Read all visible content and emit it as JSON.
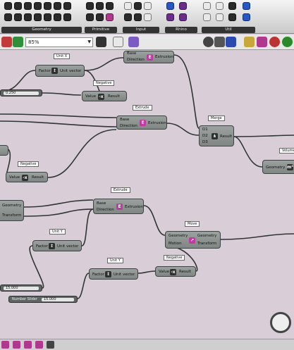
{
  "ribbon": {
    "groups": [
      {
        "label": "Geometry"
      },
      {
        "label": "Primitive"
      },
      {
        "label": "Input"
      },
      {
        "label": "Rhino"
      },
      {
        "label": "Util"
      }
    ]
  },
  "toolbar": {
    "zoom": "85%"
  },
  "canvas": {
    "unit_x_label": "Unit X",
    "unit_x_factor": "Factor",
    "unit_x_out": "Unit vector",
    "extrude1_label": "Extrude",
    "extrude1_base": "Base",
    "extrude1_direction": "Direction",
    "extrude1_out": "Extrusion",
    "slider1_value": "0.250",
    "negative1_label": "Negative",
    "negative1_value": "Value",
    "negative1_result": "Result",
    "extrude2_label": "Extrude",
    "extrude2_base": "Base",
    "extrude2_direction": "Direction",
    "extrude2_out": "Extrusion",
    "merge_label": "Merge",
    "merge_d1": "D1",
    "merge_d2": "D2",
    "merge_d3": "D3",
    "merge_result": "Result",
    "volume_label": "Volume",
    "volume_geometry": "Geometry",
    "negative2_label": "Negative",
    "negative2_value": "Value",
    "negative2_result": "Result",
    "transform_geometry": "Geometry",
    "transform_out": "Transform",
    "extrude3_label": "Extrude",
    "extrude3_base": "Base",
    "extrude3_direction": "Direction",
    "extrude3_out": "Extrusion",
    "move_label": "Move",
    "move_geometry": "Geometry",
    "move_motion": "Motion",
    "move_out_geometry": "Geometry",
    "move_out_transform": "Transform",
    "unit_y1_label": "Unit Y",
    "unit_y1_factor": "Factor",
    "unit_y1_out": "Unit vector",
    "unit_y2_label": "Unit Y",
    "unit_y2_factor": "Factor",
    "unit_y2_out": "Unit vector",
    "negative3_label": "Negative",
    "negative3_value": "Value",
    "negative3_result": "Result",
    "slider2_value": "15.000",
    "slider3_name": "Number Slider",
    "slider3_value": "15.000"
  }
}
